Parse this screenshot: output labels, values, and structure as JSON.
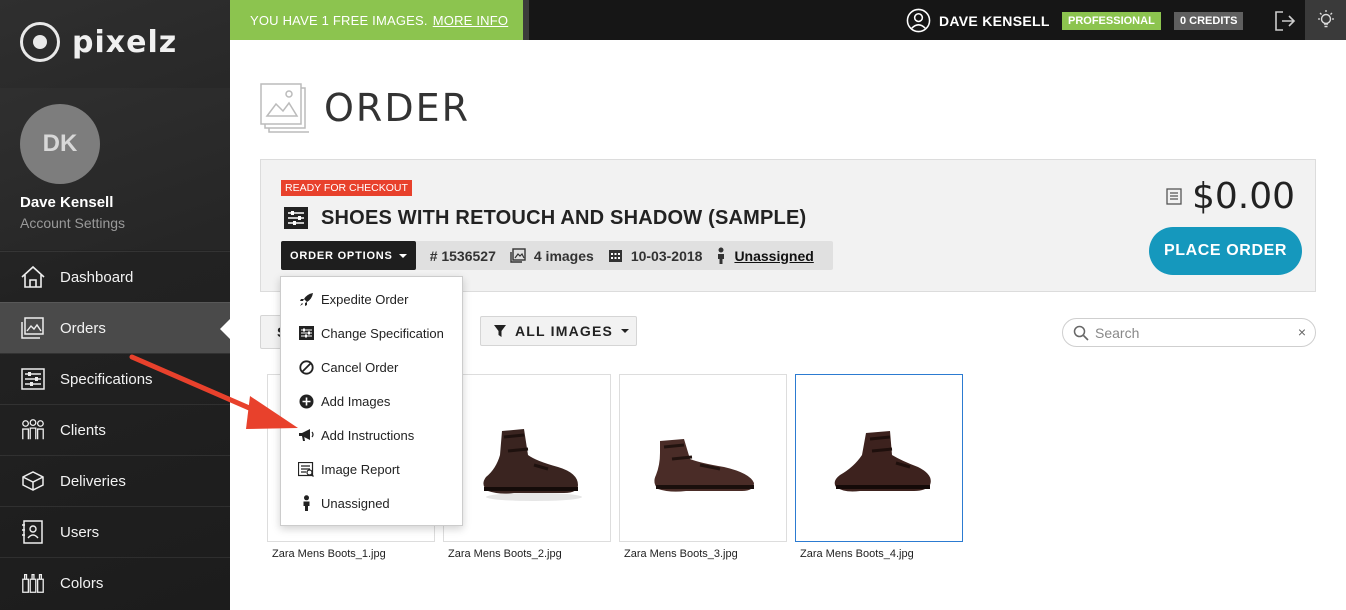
{
  "app": {
    "name": "pixelz"
  },
  "topbar": {
    "promo_text": "YOU HAVE 1 FREE IMAGES.",
    "promo_link": "MORE INFO",
    "user_name": "DAVE KENSELL",
    "plan": "PROFESSIONAL",
    "credits": "0 CREDITS"
  },
  "profile": {
    "initials": "DK",
    "name": "Dave Kensell",
    "settings_link": "Account Settings"
  },
  "sidebar": {
    "items": [
      {
        "label": "Dashboard",
        "icon": "home-icon"
      },
      {
        "label": "Orders",
        "icon": "orders-icon",
        "active": true
      },
      {
        "label": "Specifications",
        "icon": "sliders-icon"
      },
      {
        "label": "Clients",
        "icon": "people-icon"
      },
      {
        "label": "Deliveries",
        "icon": "box-icon"
      },
      {
        "label": "Users",
        "icon": "user-card-icon"
      },
      {
        "label": "Colors",
        "icon": "bottles-icon"
      }
    ]
  },
  "page": {
    "title": "ORDER"
  },
  "order": {
    "status": "READY FOR CHECKOUT",
    "name": "SHOES WITH RETOUCH AND SHADOW (SAMPLE)",
    "options_label": "ORDER OPTIONS",
    "number": "# 1536527",
    "images": "4 images",
    "date": "10-03-2018",
    "assignee": "Unassigned",
    "price": "$0.00",
    "place_order": "PLACE ORDER"
  },
  "order_options_menu": [
    {
      "label": "Expedite Order",
      "icon": "rocket-icon"
    },
    {
      "label": "Change Specification",
      "icon": "sliders-icon"
    },
    {
      "label": "Cancel Order",
      "icon": "ban-icon"
    },
    {
      "label": "Add Images",
      "icon": "plus-circle-icon"
    },
    {
      "label": "Add Instructions",
      "icon": "megaphone-icon"
    },
    {
      "label": "Image Report",
      "icon": "report-icon"
    },
    {
      "label": "Unassigned",
      "icon": "person-icon"
    }
  ],
  "toolbar": {
    "sort_label": "S",
    "filter_label": "ALL IMAGES",
    "search_placeholder": "Search",
    "clear": "×"
  },
  "images": [
    {
      "filename": "Zara Mens Boots_1.jpg"
    },
    {
      "filename": "Zara Mens Boots_2.jpg"
    },
    {
      "filename": "Zara Mens Boots_3.jpg"
    },
    {
      "filename": "Zara Mens Boots_4.jpg",
      "selected": true
    }
  ],
  "colors": {
    "accent_green": "#8cc44f",
    "place_order_blue": "#1598bd",
    "status_red": "#e8412c",
    "annotation_arrow": "#e8412c"
  }
}
